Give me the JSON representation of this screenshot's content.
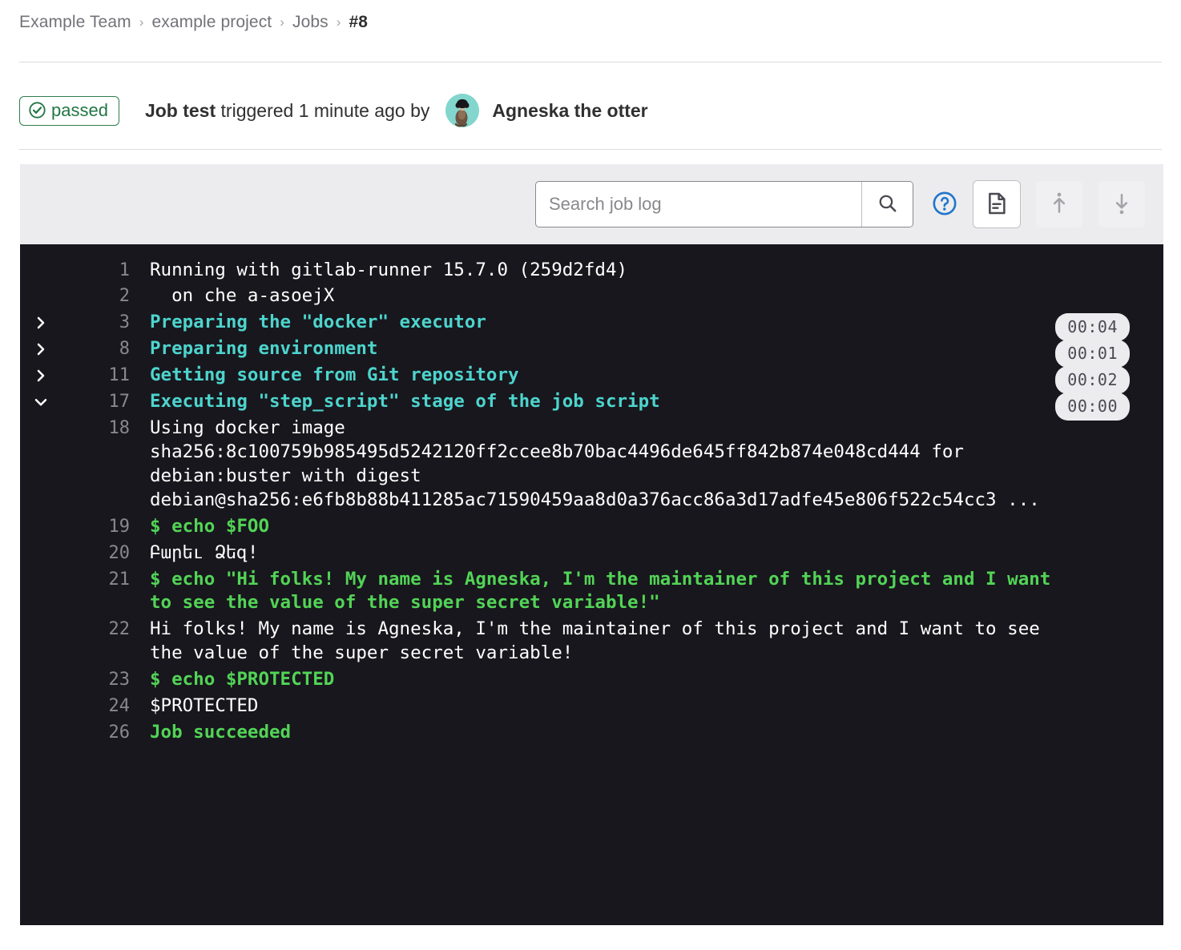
{
  "breadcrumb": {
    "items": [
      {
        "label": "Example Team",
        "current": false
      },
      {
        "label": "example project",
        "current": false
      },
      {
        "label": "Jobs",
        "current": false
      },
      {
        "label": "#8",
        "current": true
      }
    ],
    "separator": "›"
  },
  "job_header": {
    "status_label": "passed",
    "status_icon": "check-circle-icon",
    "status_color": "#217645",
    "job_name": "Job test",
    "trigger_text": " triggered 1 minute ago by",
    "user_name": "Agneska the otter",
    "avatar_bg": "#82d6cd"
  },
  "toolbar": {
    "search_placeholder": "Search job log",
    "search_value": "",
    "search_icon": "search-icon",
    "help_icon": "question-circle-icon",
    "help_color": "#1f75cb",
    "raw_button_icon": "document-icon",
    "scroll_top_icon": "scroll-to-top-icon",
    "scroll_bottom_icon": "scroll-to-bottom-icon",
    "scroll_top_disabled": true,
    "scroll_bottom_disabled": true
  },
  "log": {
    "background": "#18171d",
    "section_color": "#4dd4cd",
    "command_color": "#52d456",
    "lineno_color": "#89888d",
    "lines": [
      {
        "num": "1",
        "text": "Running with gitlab-runner 15.7.0 (259d2fd4)",
        "style": "plain",
        "toggle": "",
        "duration": ""
      },
      {
        "num": "2",
        "text": "  on che a-asoejX",
        "style": "plain",
        "toggle": "",
        "duration": ""
      },
      {
        "num": "3",
        "text": "Preparing the \"docker\" executor",
        "style": "section",
        "toggle": "collapsed",
        "duration": "00:04"
      },
      {
        "num": "8",
        "text": "Preparing environment",
        "style": "section",
        "toggle": "collapsed",
        "duration": "00:01"
      },
      {
        "num": "11",
        "text": "Getting source from Git repository",
        "style": "section",
        "toggle": "collapsed",
        "duration": "00:02"
      },
      {
        "num": "17",
        "text": "Executing \"step_script\" stage of the job script",
        "style": "section",
        "toggle": "expanded",
        "duration": "00:00"
      },
      {
        "num": "18",
        "text": "Using docker image sha256:8c100759b985495d5242120ff2ccee8b70bac4496de645ff842b874e048cd444 for debian:buster with digest debian@sha256:e6fb8b88b411285ac71590459aa8d0a376acc86a3d17adfe45e806f522c54cc3 ...",
        "style": "plain",
        "toggle": "",
        "duration": ""
      },
      {
        "num": "19",
        "text": "$ echo $FOO",
        "style": "cmd",
        "toggle": "",
        "duration": ""
      },
      {
        "num": "20",
        "text": "Բարեւ Ձեզ!",
        "style": "plain",
        "toggle": "",
        "duration": ""
      },
      {
        "num": "21",
        "text": "$ echo \"Hi folks! My name is Agneska, I'm the maintainer of this project and I want to see the value of the super secret variable!\"",
        "style": "cmd",
        "toggle": "",
        "duration": ""
      },
      {
        "num": "22",
        "text": "Hi folks! My name is Agneska, I'm the maintainer of this project and I want to see the value of the super secret variable!",
        "style": "plain",
        "toggle": "",
        "duration": ""
      },
      {
        "num": "23",
        "text": "$ echo $PROTECTED",
        "style": "cmd",
        "toggle": "",
        "duration": ""
      },
      {
        "num": "24",
        "text": "$PROTECTED",
        "style": "plain",
        "toggle": "",
        "duration": ""
      },
      {
        "num": "26",
        "text": "Job succeeded",
        "style": "ok",
        "toggle": "",
        "duration": ""
      }
    ]
  }
}
